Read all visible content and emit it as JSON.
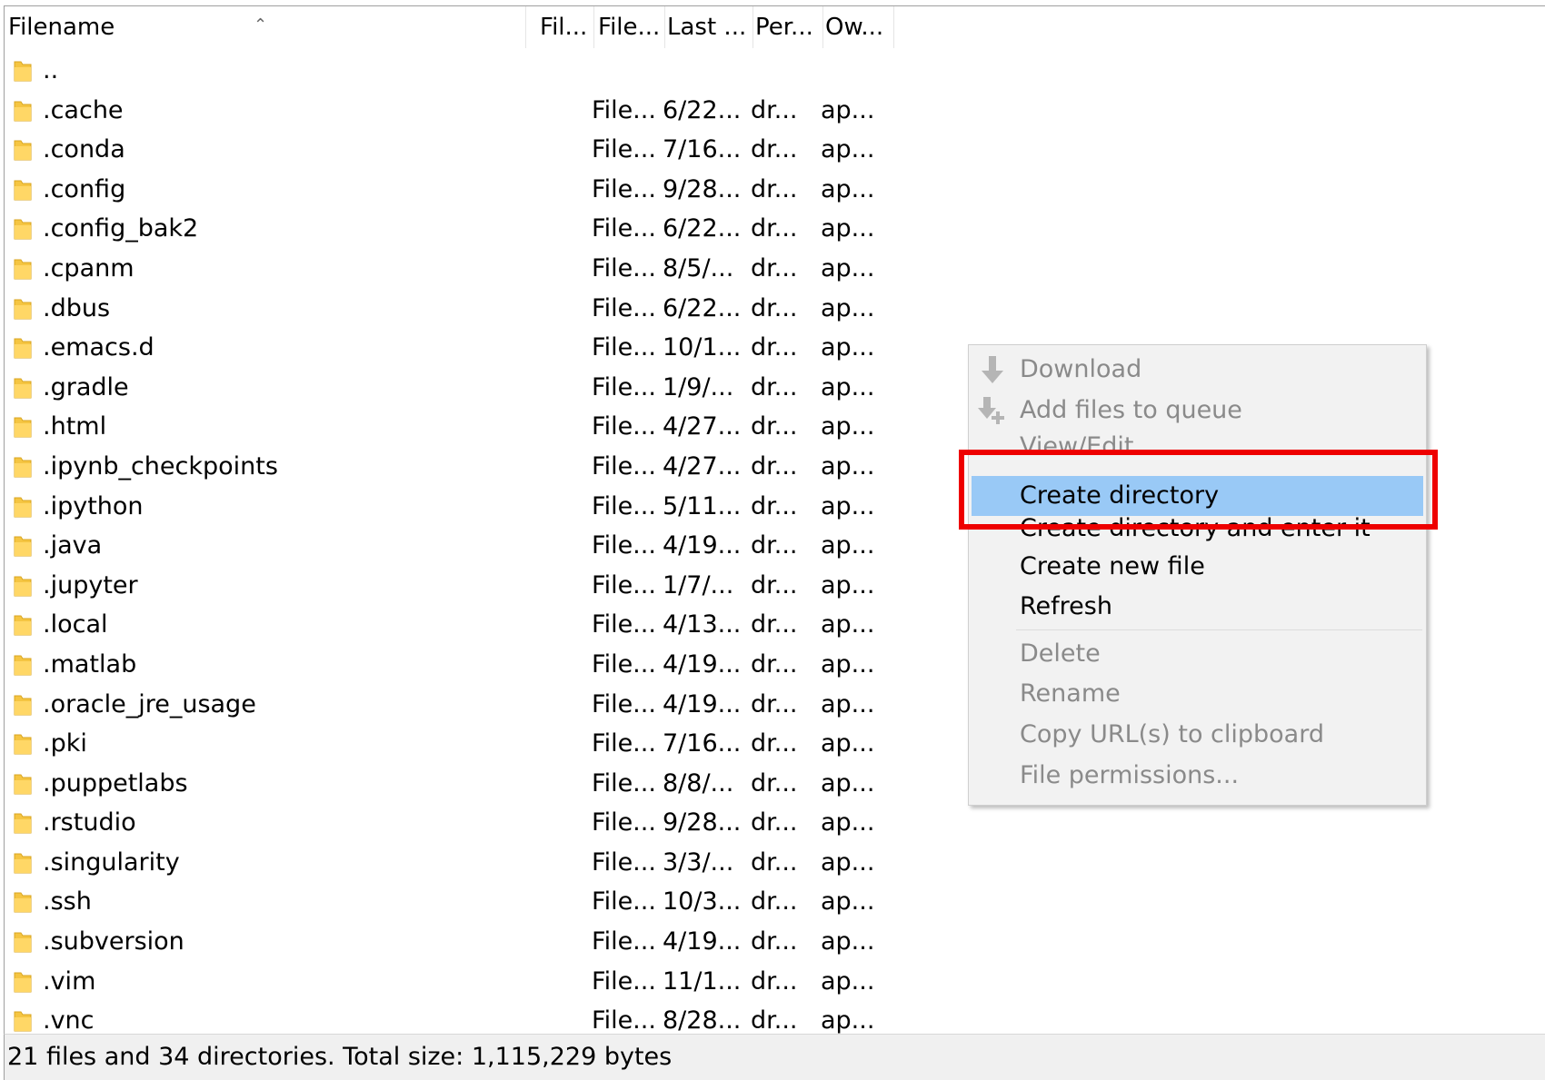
{
  "header": {
    "columns": [
      "Filename",
      "Fil...",
      "File...",
      "Last ...",
      "Per...",
      "Ow..."
    ],
    "sort_indicator": "^"
  },
  "files": [
    {
      "name": "..",
      "type": "",
      "date": "",
      "perm": "",
      "owner": ""
    },
    {
      "name": ".cache",
      "type": "File...",
      "date": "6/22...",
      "perm": "dr...",
      "owner": "ap..."
    },
    {
      "name": ".conda",
      "type": "File...",
      "date": "7/16...",
      "perm": "dr...",
      "owner": "ap..."
    },
    {
      "name": ".config",
      "type": "File...",
      "date": "9/28...",
      "perm": "dr...",
      "owner": "ap..."
    },
    {
      "name": ".config_bak2",
      "type": "File...",
      "date": "6/22...",
      "perm": "dr...",
      "owner": "ap..."
    },
    {
      "name": ".cpanm",
      "type": "File...",
      "date": "8/5/...",
      "perm": "dr...",
      "owner": "ap..."
    },
    {
      "name": ".dbus",
      "type": "File...",
      "date": "6/22...",
      "perm": "dr...",
      "owner": "ap..."
    },
    {
      "name": ".emacs.d",
      "type": "File...",
      "date": "10/1...",
      "perm": "dr...",
      "owner": "ap..."
    },
    {
      "name": ".gradle",
      "type": "File...",
      "date": "1/9/...",
      "perm": "dr...",
      "owner": "ap..."
    },
    {
      "name": ".html",
      "type": "File...",
      "date": "4/27...",
      "perm": "dr...",
      "owner": "ap..."
    },
    {
      "name": ".ipynb_checkpoints",
      "type": "File...",
      "date": "4/27...",
      "perm": "dr...",
      "owner": "ap..."
    },
    {
      "name": ".ipython",
      "type": "File...",
      "date": "5/11...",
      "perm": "dr...",
      "owner": "ap..."
    },
    {
      "name": ".java",
      "type": "File...",
      "date": "4/19...",
      "perm": "dr...",
      "owner": "ap..."
    },
    {
      "name": ".jupyter",
      "type": "File...",
      "date": "1/7/...",
      "perm": "dr...",
      "owner": "ap..."
    },
    {
      "name": ".local",
      "type": "File...",
      "date": "4/13...",
      "perm": "dr...",
      "owner": "ap..."
    },
    {
      "name": ".matlab",
      "type": "File...",
      "date": "4/19...",
      "perm": "dr...",
      "owner": "ap..."
    },
    {
      "name": ".oracle_jre_usage",
      "type": "File...",
      "date": "4/19...",
      "perm": "dr...",
      "owner": "ap..."
    },
    {
      "name": ".pki",
      "type": "File...",
      "date": "7/16...",
      "perm": "dr...",
      "owner": "ap..."
    },
    {
      "name": ".puppetlabs",
      "type": "File...",
      "date": "8/8/...",
      "perm": "dr...",
      "owner": "ap..."
    },
    {
      "name": ".rstudio",
      "type": "File...",
      "date": "9/28...",
      "perm": "dr...",
      "owner": "ap..."
    },
    {
      "name": ".singularity",
      "type": "File...",
      "date": "3/3/...",
      "perm": "dr...",
      "owner": "ap..."
    },
    {
      "name": ".ssh",
      "type": "File...",
      "date": "10/3...",
      "perm": "dr...",
      "owner": "ap..."
    },
    {
      "name": ".subversion",
      "type": "File...",
      "date": "4/19...",
      "perm": "dr...",
      "owner": "ap..."
    },
    {
      "name": ".vim",
      "type": "File...",
      "date": "11/1...",
      "perm": "dr...",
      "owner": "ap..."
    },
    {
      "name": ".vnc",
      "type": "File...",
      "date": "8/28...",
      "perm": "dr...",
      "owner": "ap..."
    }
  ],
  "status": "21 files and 34 directories. Total size: 1,115,229 bytes",
  "context_menu": {
    "download": "Download",
    "add_to_queue": "Add files to queue",
    "view_edit": "View/Edit",
    "create_directory": "Create directory",
    "create_directory_enter": "Create directory and enter it",
    "create_new_file": "Create new file",
    "refresh": "Refresh",
    "delete": "Delete",
    "rename": "Rename",
    "copy_urls": "Copy URL(s) to clipboard",
    "file_permissions": "File permissions..."
  },
  "colors": {
    "highlight": "#99c9f6",
    "annotation_box": "#ee0000",
    "folder": "#f5c542"
  }
}
